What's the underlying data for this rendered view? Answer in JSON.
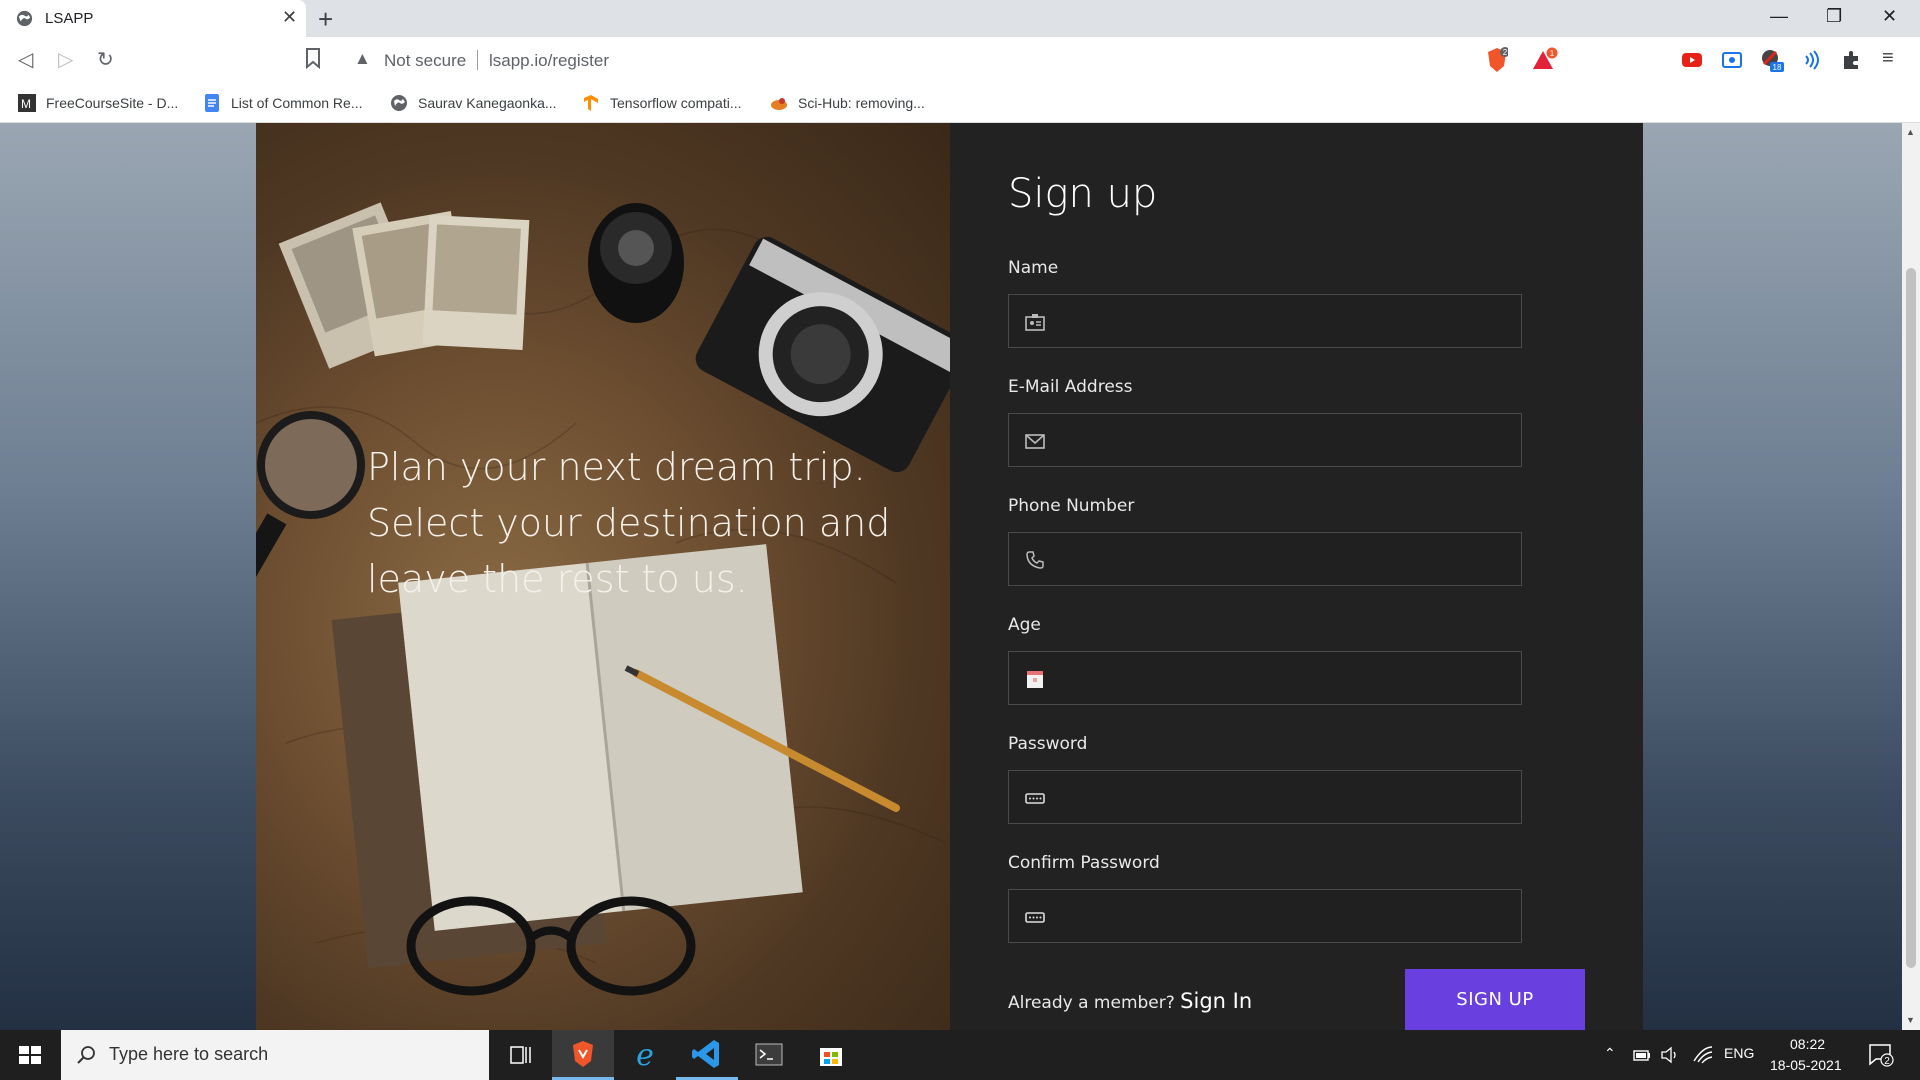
{
  "browser": {
    "tab_title": "LSAPP",
    "tab_close": "✕",
    "new_tab": "+",
    "not_secure": "Not secure",
    "url": "lsapp.io/register",
    "shield_badge": "2",
    "rewards_badge": "1",
    "ext_badge": "18",
    "bookmarks": [
      {
        "label": "FreeCourseSite - D..."
      },
      {
        "label": "List of Common Re..."
      },
      {
        "label": "Saurav Kanegaonka..."
      },
      {
        "label": "Tensorflow compati..."
      },
      {
        "label": "Sci-Hub: removing..."
      }
    ]
  },
  "hero": {
    "tagline": "Plan your next dream trip. Select your destination and leave the rest to us."
  },
  "form": {
    "title": "Sign up",
    "fields": [
      {
        "label": "Name",
        "icon": "id-card-icon"
      },
      {
        "label": "E-Mail Address",
        "icon": "mail-icon"
      },
      {
        "label": "Phone Number",
        "icon": "phone-icon"
      },
      {
        "label": "Age",
        "icon": "calendar-icon"
      },
      {
        "label": "Password",
        "icon": "password-icon"
      },
      {
        "label": "Confirm Password",
        "icon": "password-icon"
      }
    ],
    "already_member": "Already a member? ",
    "sign_in": "Sign In",
    "submit": "SIGN UP"
  },
  "taskbar": {
    "search_placeholder": "Type here to search",
    "language": "ENG",
    "time": "08:22",
    "date": "18-05-2021",
    "notifications": "2"
  },
  "colors": {
    "accent": "#6a3fe0",
    "form_bg": "#222222"
  }
}
